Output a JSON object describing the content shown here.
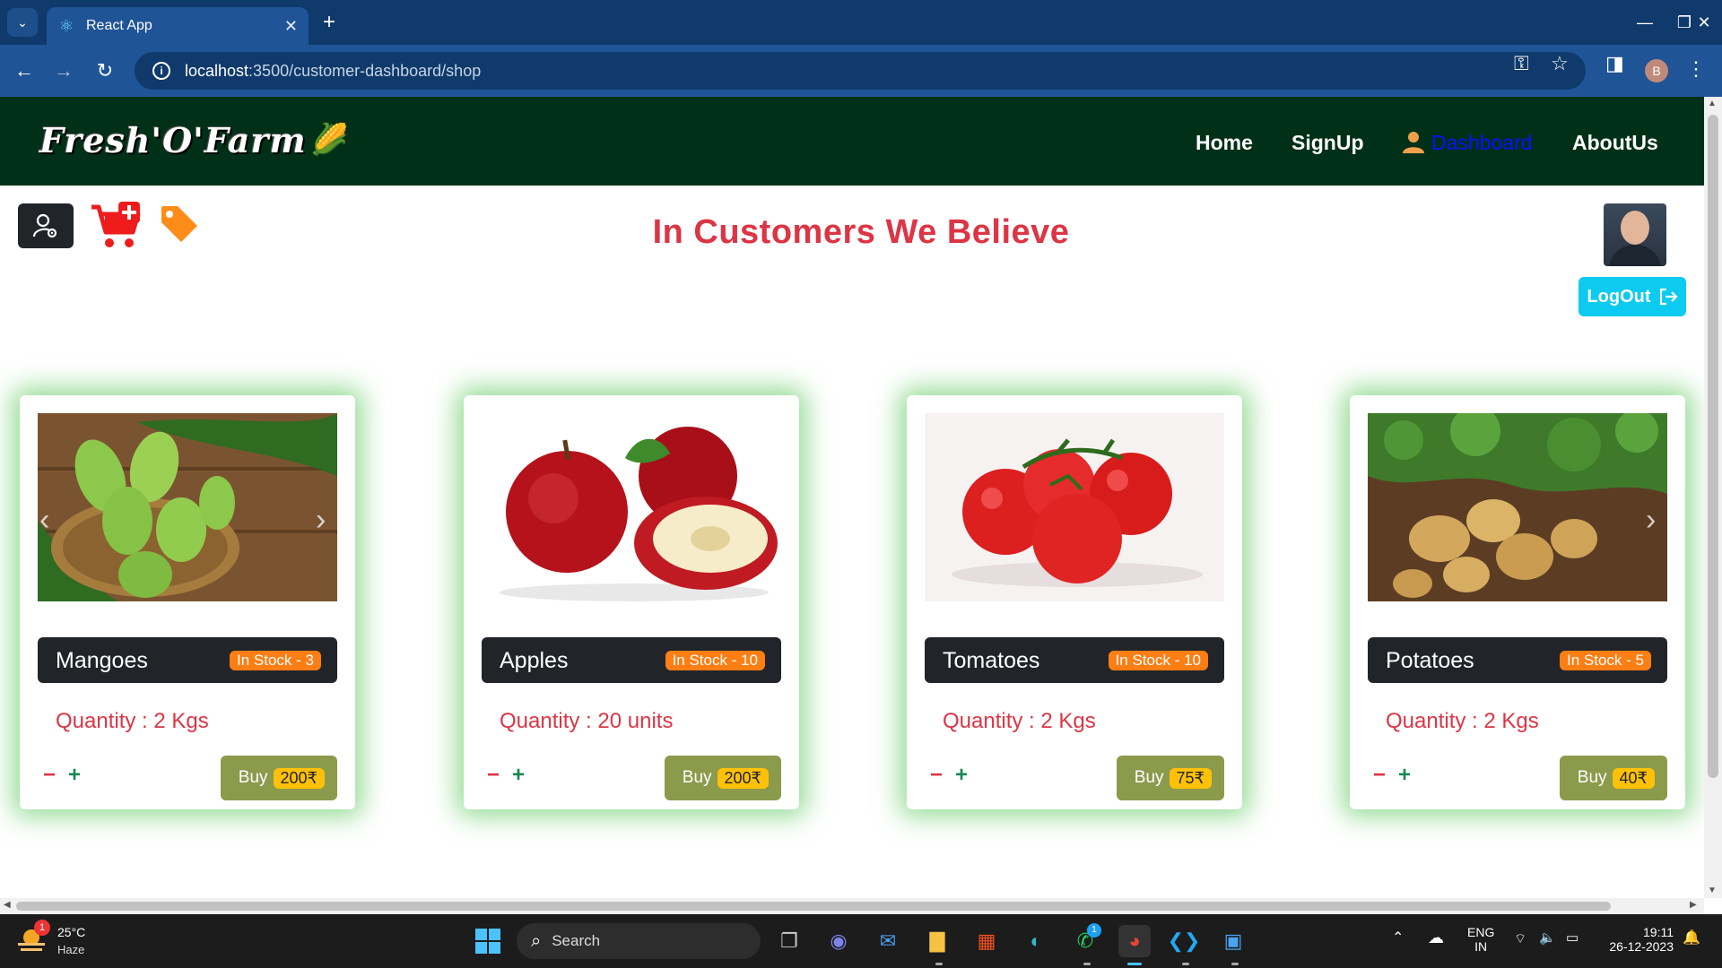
{
  "browser": {
    "tab_title": "React App",
    "url_host": "localhost",
    "url_path": ":3500/customer-dashboard/shop"
  },
  "site": {
    "logo": "Fresh'O'Farm",
    "nav": [
      "Home",
      "SignUp",
      "Dashboard",
      "AboutUs"
    ],
    "tagline": "In Customers We Believe",
    "logout_label": "LogOut"
  },
  "products": [
    {
      "name": "Mangoes",
      "stock": "In Stock - 3",
      "quantity": "Quantity : 2 Kgs",
      "buy_label": "Buy",
      "price": "200₹"
    },
    {
      "name": "Apples",
      "stock": "In Stock - 10",
      "quantity": "Quantity : 20 units",
      "buy_label": "Buy",
      "price": "200₹"
    },
    {
      "name": "Tomatoes",
      "stock": "In Stock - 10",
      "quantity": "Quantity : 2 Kgs",
      "buy_label": "Buy",
      "price": "75₹"
    },
    {
      "name": "Potatoes",
      "stock": "In Stock - 5",
      "quantity": "Quantity : 2 Kgs",
      "buy_label": "Buy",
      "price": "40₹"
    }
  ],
  "taskbar": {
    "weather_temp": "25°C",
    "weather_cond": "Haze",
    "weather_badge": "1",
    "search_label": "Search",
    "lang_top": "ENG",
    "lang_bottom": "IN",
    "time": "19:11",
    "date": "26-12-2023",
    "whatsapp_badge": "1"
  },
  "colors": {
    "header_bg": "#003018",
    "accent_red": "#dc3545",
    "stock_badge": "#fd7e14",
    "buy_button": "#8c9a4c",
    "price_badge": "#ffc107",
    "logout_button": "#0dcaf0",
    "card_glow": "#3cbe3c"
  }
}
